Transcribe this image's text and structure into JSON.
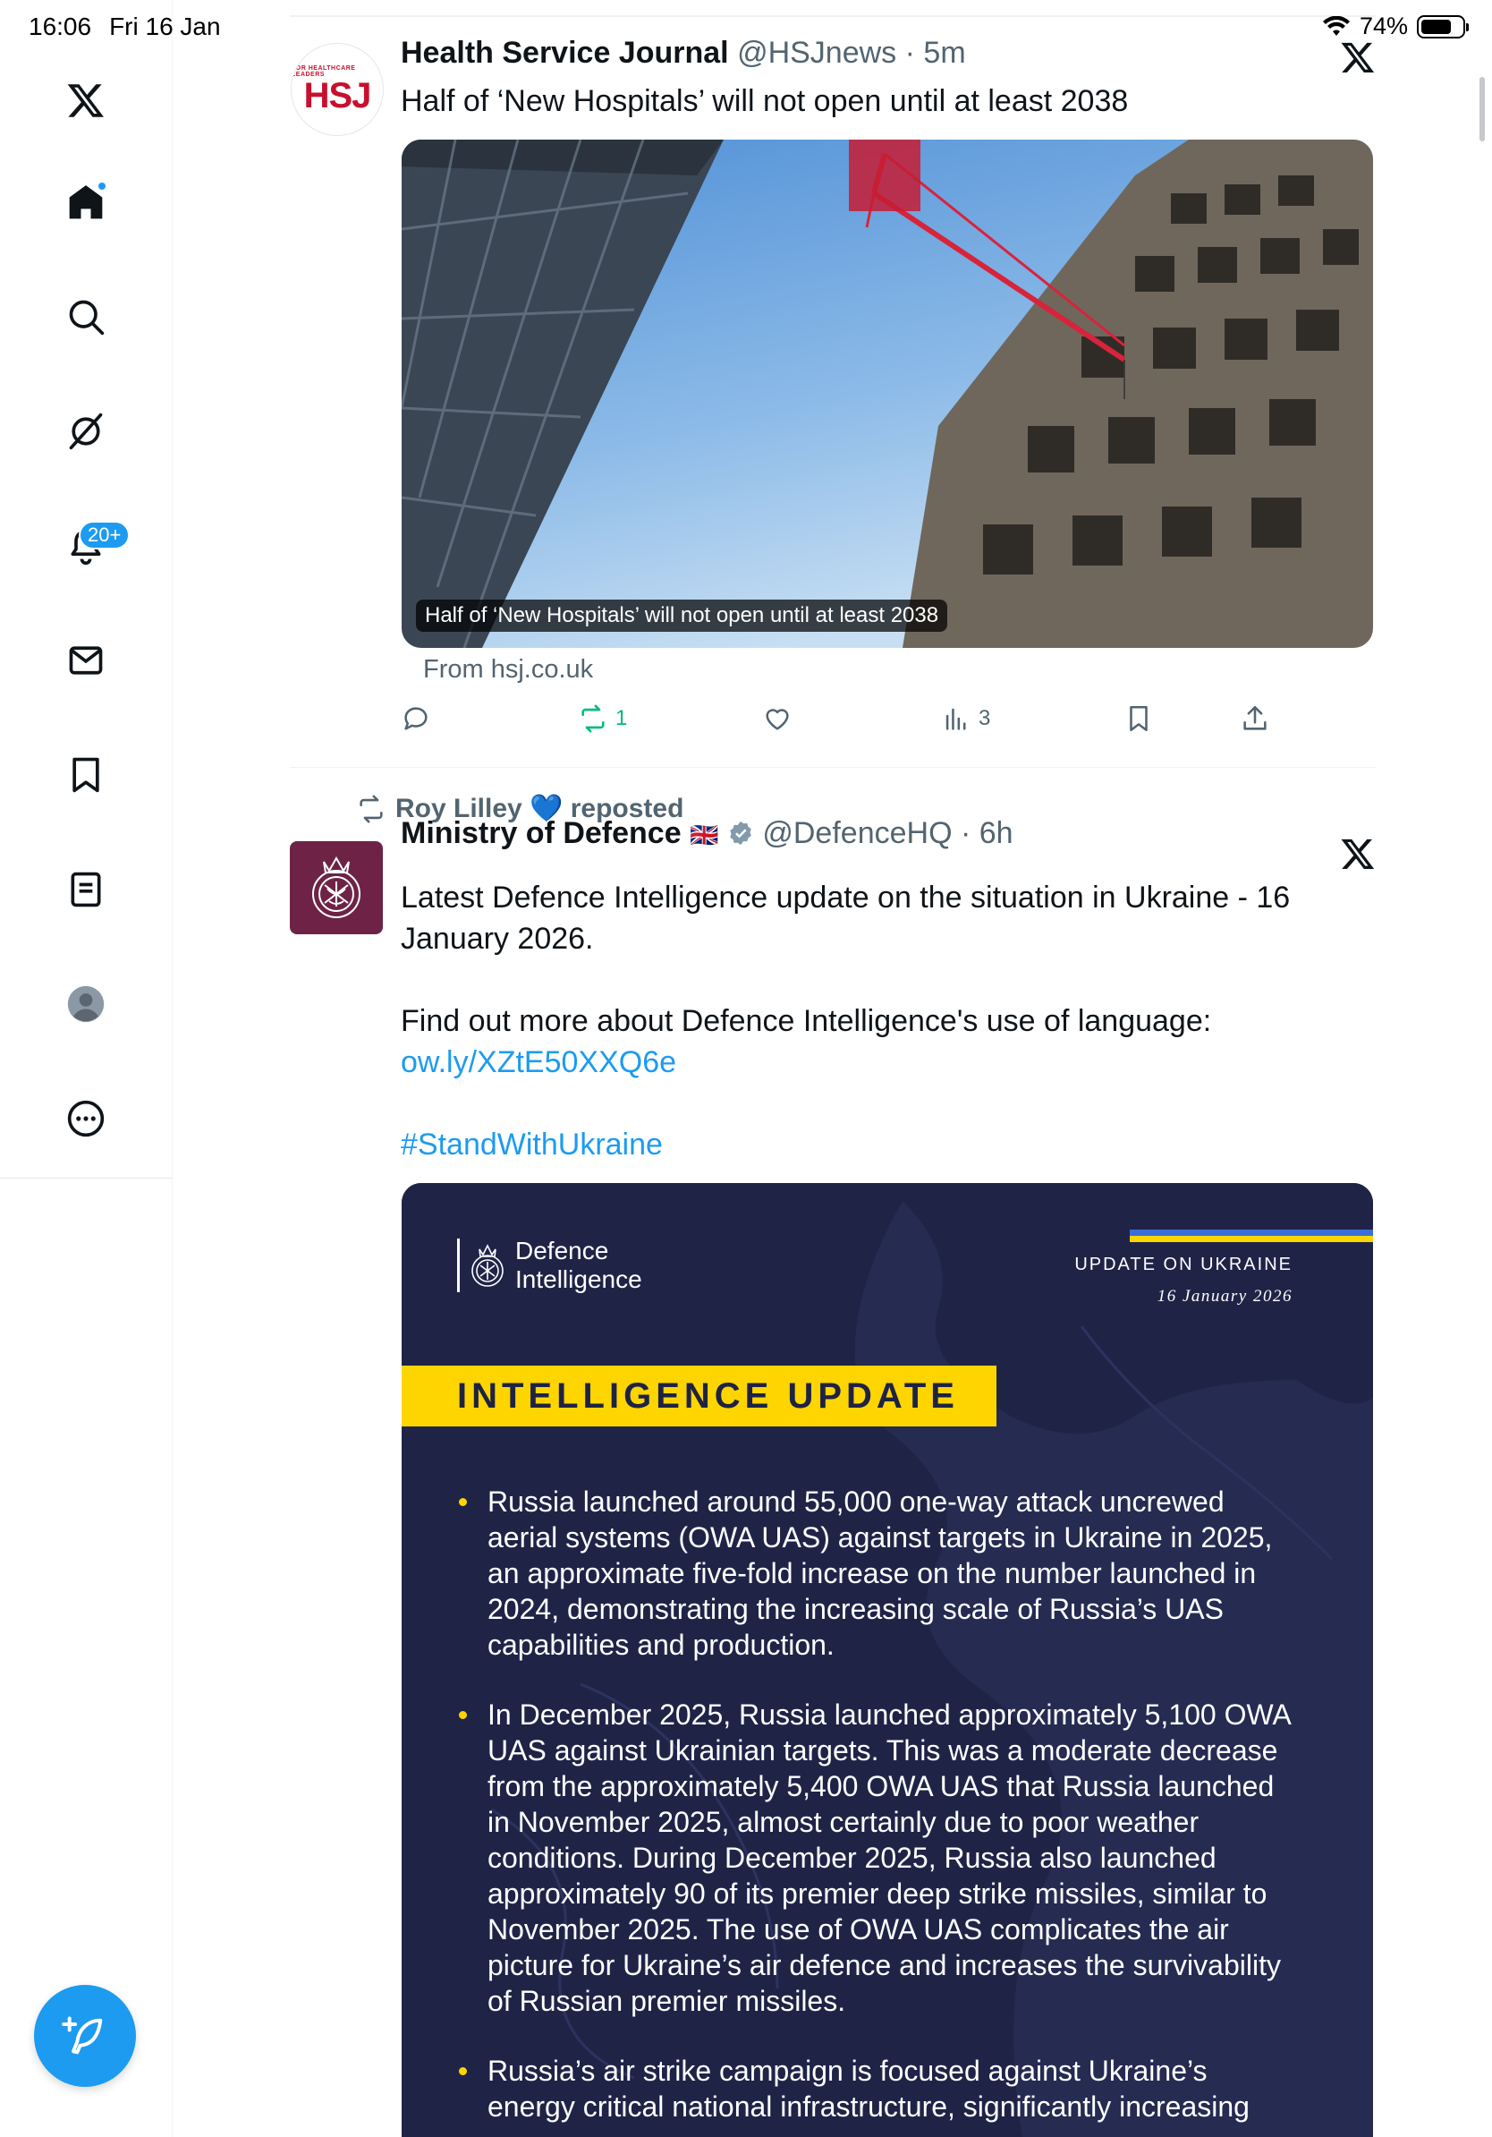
{
  "status_bar": {
    "time": "16:06",
    "date": "Fri 16 Jan",
    "battery": "74%",
    "battery_level": 0.74
  },
  "sidebar": {
    "items": [
      {
        "name": "home",
        "icon": "home-icon",
        "has_dot": true
      },
      {
        "name": "explore",
        "icon": "search-icon"
      },
      {
        "name": "grok",
        "icon": "grok-icon"
      },
      {
        "name": "notifications",
        "icon": "bell-icon",
        "badge": "20+"
      },
      {
        "name": "messages",
        "icon": "mail-icon"
      },
      {
        "name": "bookmarks",
        "icon": "bookmark-icon"
      },
      {
        "name": "lists",
        "icon": "list-icon"
      },
      {
        "name": "profile",
        "icon": "profile-icon"
      },
      {
        "name": "more",
        "icon": "more-icon"
      }
    ],
    "compose_icon": "feather-plus-icon"
  },
  "tweets": [
    {
      "author_name": "Health Service Journal",
      "handle": "@HSJnews",
      "time": "5m",
      "avatar_text_small": "FOR HEALTHCARE LEADERS",
      "avatar_text_big": "HSJ",
      "text": "Half of ‘New Hospitals’ will not open until at least 2038",
      "image_caption": "Half of ‘New Hospitals’ will not open until at least 2038",
      "source": "From hsj.co.uk",
      "actions": {
        "reply": "",
        "repost": "1",
        "like": "",
        "views": "3"
      },
      "repost_color": "#00ba7c"
    },
    {
      "reposted_by": "Roy Lilley 💙 reposted",
      "author_name": "Ministry of Defence",
      "flag": "🇬🇧",
      "handle": "@DefenceHQ",
      "time": "6h",
      "text_line1": "Latest Defence Intelligence update on the situation in Ukraine - 16 January 2026.",
      "text_line2_prefix": "Find out more about Defence Intelligence's use of language: ",
      "link": "ow.ly/XZtE50XXQ6e",
      "hashtag": "#StandWithUkraine",
      "infographic": {
        "logo_line1": "Defence",
        "logo_line2": "Intelligence",
        "header_title": "UPDATE ON UKRAINE",
        "header_date": "16 January 2026",
        "banner": "INTELLIGENCE UPDATE",
        "bullets": [
          "Russia launched around 55,000 one-way attack uncrewed aerial systems (OWA UAS) against targets in Ukraine in 2025, an approximate five-fold increase on the number launched in 2024, demonstrating the increasing scale of Russia’s UAS capabilities and production.",
          "In December 2025, Russia launched approximately 5,100 OWA UAS against Ukrainian targets. This was a moderate decrease from the approximately 5,400 OWA UAS that Russia launched in November 2025, almost certainly due to poor weather conditions. During December 2025, Russia also launched approximately 90 of its premier deep strike missiles, similar to November 2025. The use of OWA UAS complicates the air picture for Ukraine’s air defence and increases the survivability of Russian premier missiles.",
          "Russia’s air strike campaign is focused against Ukraine’s energy critical national infrastructure, significantly increasing"
        ]
      }
    }
  ],
  "colors": {
    "accent": "#1d9bf0",
    "text": "#0f1419",
    "muted": "#536471",
    "infographic_bg": "#1e2343",
    "infographic_yellow": "#ffd500",
    "mod_avatar": "#6e2346",
    "hsj_red": "#c8102e"
  }
}
